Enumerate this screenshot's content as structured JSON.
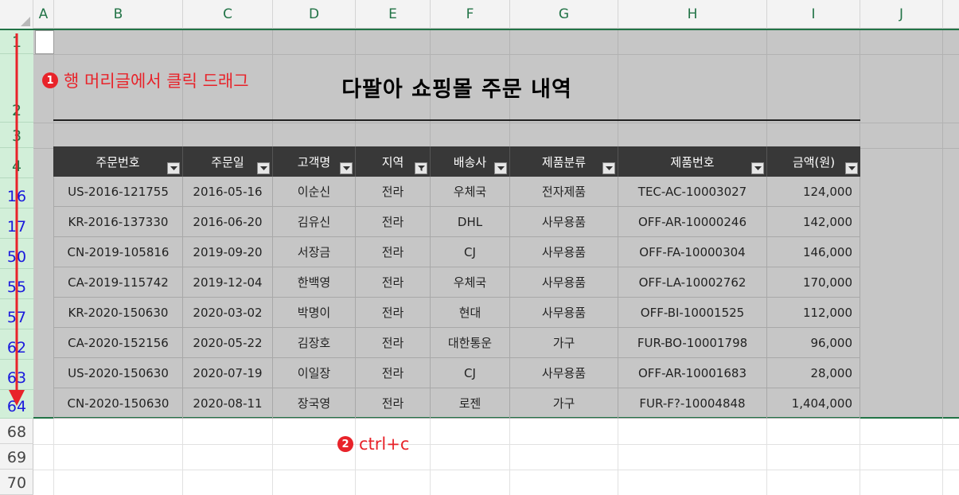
{
  "columns": [
    "A",
    "B",
    "C",
    "D",
    "E",
    "F",
    "G",
    "H",
    "I",
    "J"
  ],
  "row_numbers": [
    "1",
    "2",
    "3",
    "4",
    "16",
    "17",
    "50",
    "55",
    "57",
    "62",
    "63",
    "64",
    "68",
    "69",
    "70"
  ],
  "sheet": {
    "title": "다팔아 쇼핑몰 주문 내역",
    "headers": [
      "주문번호",
      "주문일",
      "고객명",
      "지역",
      "배송사",
      "제품분류",
      "제품번호",
      "금액(원)"
    ],
    "rows": [
      [
        "US-2016-121755",
        "2016-05-16",
        "이순신",
        "전라",
        "우체국",
        "전자제품",
        "TEC-AC-10003027",
        "124,000"
      ],
      [
        "KR-2016-137330",
        "2016-06-20",
        "김유신",
        "전라",
        "DHL",
        "사무용품",
        "OFF-AR-10000246",
        "142,000"
      ],
      [
        "CN-2019-105816",
        "2019-09-20",
        "서장금",
        "전라",
        "CJ",
        "사무용품",
        "OFF-FA-10000304",
        "146,000"
      ],
      [
        "CA-2019-115742",
        "2019-12-04",
        "한백영",
        "전라",
        "우체국",
        "사무용품",
        "OFF-LA-10002762",
        "170,000"
      ],
      [
        "KR-2020-150630",
        "2020-03-02",
        "박명이",
        "전라",
        "현대",
        "사무용품",
        "OFF-BI-10001525",
        "112,000"
      ],
      [
        "CA-2020-152156",
        "2020-05-22",
        "김장호",
        "전라",
        "대한통운",
        "가구",
        "FUR-BO-10001798",
        "96,000"
      ],
      [
        "US-2020-150630",
        "2020-07-19",
        "이일장",
        "전라",
        "CJ",
        "사무용품",
        "OFF-AR-10001683",
        "28,000"
      ],
      [
        "CN-2020-150630",
        "2020-08-11",
        "장국영",
        "전라",
        "로젠",
        "가구",
        "FUR-F?-10004848",
        "1,404,000"
      ]
    ],
    "active_filter_column": "지역"
  },
  "annotations": {
    "step1_badge": "❶",
    "step1_text": "행 머리글에서 클릭 드래그",
    "step2_badge": "❷",
    "step2_text": "ctrl+c"
  },
  "colors": {
    "excel_green": "#217346",
    "selection_fill": "#c6c6c6",
    "header_fill": "#383838",
    "annotation_red": "#e8232a",
    "filtered_row_number": "#1a1adc"
  },
  "icons": {
    "filter_dropdown": "dropdown-arrow-icon",
    "filter_active": "filter-funnel-icon",
    "drag": "down-arrow-icon"
  }
}
